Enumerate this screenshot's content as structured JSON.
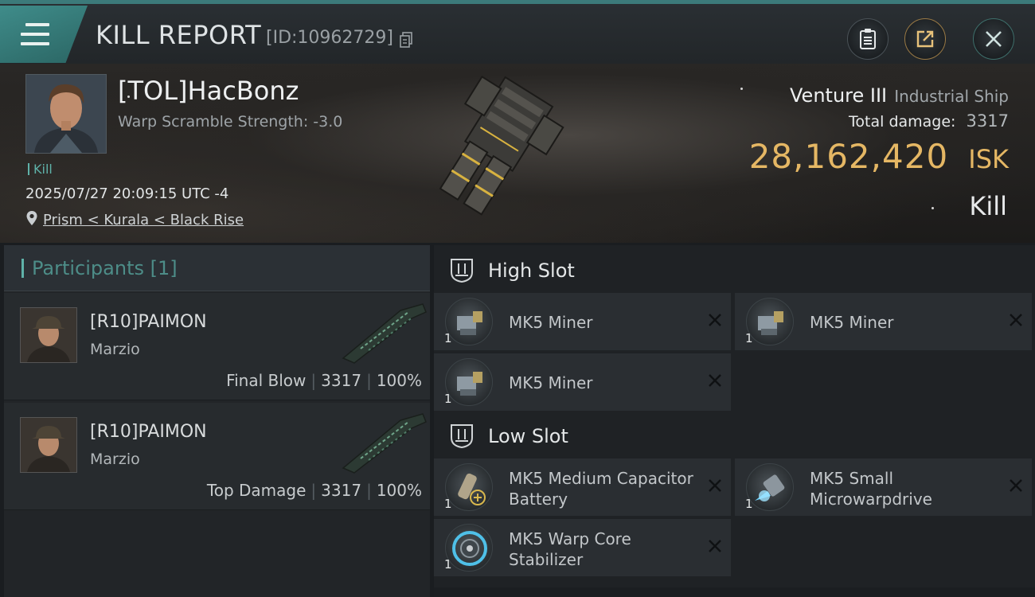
{
  "header": {
    "title": "KILL REPORT",
    "report_id": "[ID:10962729]"
  },
  "victim": {
    "name": "[TOL]HacBonz",
    "warp_scramble": "Warp Scramble Strength: -3.0",
    "tag": "Kill",
    "datetime": "2025/07/27 20:09:15 UTC -4",
    "location": "Prism < Kurala < Black Rise"
  },
  "ship": {
    "name": "Venture III",
    "class": "Industrial Ship",
    "damage_label": "Total damage:",
    "damage_value": "3317",
    "isk_value": "28,162,420",
    "isk_unit": "ISK",
    "result": "Kill"
  },
  "participants": {
    "title": "Participants [1]",
    "items": [
      {
        "name": "[R10]PAIMON",
        "corp": "Marzio",
        "role": "Final Blow",
        "damage": "3317",
        "percent": "100%"
      },
      {
        "name": "[R10]PAIMON",
        "corp": "Marzio",
        "role": "Top Damage",
        "damage": "3317",
        "percent": "100%"
      }
    ]
  },
  "fitting": {
    "high_slot": {
      "title": "High Slot",
      "modules": [
        {
          "name": "MK5 Miner",
          "qty": "1"
        },
        {
          "name": "MK5 Miner",
          "qty": "1"
        },
        {
          "name": "MK5 Miner",
          "qty": "1"
        }
      ]
    },
    "low_slot": {
      "title": "Low Slot",
      "modules": [
        {
          "name": "MK5 Medium Capacitor Battery",
          "qty": "1"
        },
        {
          "name": "MK5 Small Microwarpdrive",
          "qty": "1"
        },
        {
          "name": "MK5 Warp Core Stabilizer",
          "qty": "1"
        }
      ]
    }
  },
  "colors": {
    "accent_teal": "#5fb2a9",
    "isk_gold": "#e5b764"
  }
}
